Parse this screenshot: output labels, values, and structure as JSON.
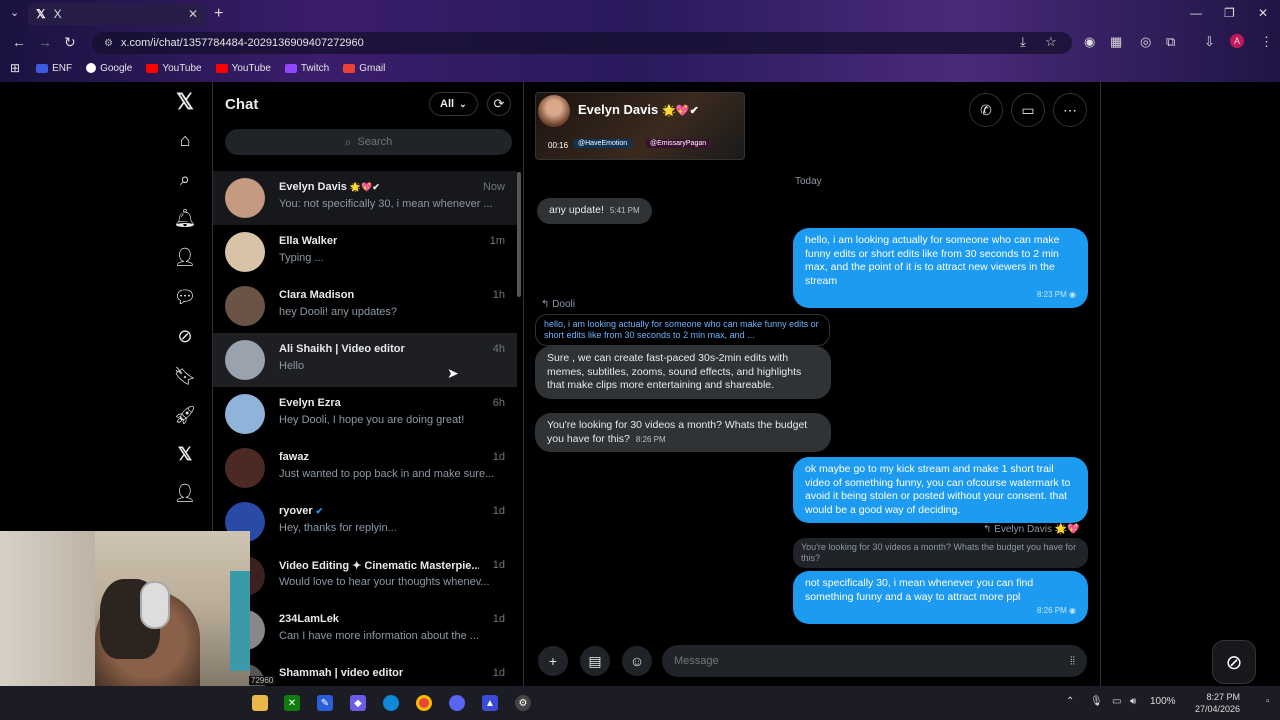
{
  "browser": {
    "tab_title": "X",
    "url": "x.com/i/chat/1357784484-2029136909407272960",
    "bookmarks": [
      {
        "label": "ENF",
        "color": "#3b5bdb"
      },
      {
        "label": "Google",
        "color": "#ffffff"
      },
      {
        "label": "YouTube",
        "color": "#ff0000"
      },
      {
        "label": "YouTube",
        "color": "#ff0000"
      },
      {
        "label": "Twitch",
        "color": "#9146ff"
      },
      {
        "label": "Gmail",
        "color": "#ea4335"
      }
    ]
  },
  "nav": {
    "items": [
      "x-logo-icon",
      "home-icon",
      "search-icon",
      "notifications-icon",
      "follow-icon",
      "chat-icon",
      "grok-icon",
      "bookmarks-icon",
      "rocket-icon",
      "premium-icon",
      "profile-icon"
    ]
  },
  "chatlist": {
    "title": "Chat",
    "filter_label": "All",
    "search_placeholder": "Search",
    "conversations": [
      {
        "name": "Evelyn Davis",
        "badge": "🌟💖✔",
        "time": "Now",
        "preview": "You: not specifically 30, i mean whenever ...",
        "avatar_color": "#c59a80"
      },
      {
        "name": "Ella Walker",
        "badge": "",
        "time": "1m",
        "preview": "Typing ...",
        "avatar_color": "#d9c3a8"
      },
      {
        "name": "Clara Madison",
        "badge": "",
        "time": "1h",
        "preview": "hey Dooli! any updates?",
        "avatar_color": "#6b5446"
      },
      {
        "name": "Ali Shaikh | Video editor",
        "badge": "",
        "time": "4h",
        "preview": "Hello",
        "avatar_color": "#9aa3ad"
      },
      {
        "name": "Evelyn Ezra",
        "badge": "",
        "time": "6h",
        "preview": "Hey Dooli, I hope you are doing great!",
        "avatar_color": "#8fb3d9"
      },
      {
        "name": "fawaz",
        "badge": "",
        "time": "1d",
        "preview": "Just wanted to pop back in and make sure...",
        "avatar_color": "#4a2a22"
      },
      {
        "name": "ryover",
        "badge": "✔",
        "time": "1d",
        "preview": "Hey, thanks for replyin...",
        "avatar_color": "#2a4aa8"
      },
      {
        "name": "Video Editing ✦ Cinematic Masterpie...",
        "badge": "",
        "time": "1d",
        "preview": "Would love to hear your thoughts whenev...",
        "avatar_color": "#3a2020"
      },
      {
        "name": "234LamLek",
        "badge": "",
        "time": "1d",
        "preview": "Can I have more information about the ...",
        "avatar_color": "#888888"
      },
      {
        "name": "Shammah | video editor",
        "badge": "",
        "time": "1d",
        "preview": "",
        "avatar_color": "#555555"
      }
    ]
  },
  "chat": {
    "contact_name": "Evelyn Davis",
    "contact_badges": "🌟💖✔",
    "video_time": "00:16",
    "video_tag1": "@HaveEmotion",
    "video_tag2": "@EmissaryPagan",
    "day_separator": "Today",
    "messages": {
      "m1": {
        "text": "any update!",
        "time": "5:41 PM"
      },
      "m2": {
        "text": "hello, i am looking actually for someone who can make funny edits or short edits like from 30 seconds to 2 min max, and the point of it is to attract new viewers in the stream",
        "time": "8:23 PM"
      },
      "q1_label": "Dooli",
      "q1_text": "hello, i am looking actually for someone who can make funny edits or short edits like from 30 seconds to 2 min max, and ...",
      "m3": {
        "text": "Sure , we can create fast-paced 30s-2min edits with memes, subtitles, zooms, sound effects, and highlights that make clips more entertaining and shareable.",
        "time": ""
      },
      "m4": {
        "text": "You're looking for 30 videos a month? Whats the budget you have for this?",
        "time": "8:26 PM"
      },
      "m5": {
        "text": "ok maybe go to my kick stream and make 1 short trail video of something funny, you can ofcourse watermark to avoid it being stolen or posted without your consent. that would be a good way of deciding.",
        "time": ""
      },
      "q2_label": "Evelyn Davis 🌟💖",
      "q2_text": "You're looking for 30 videos a month? Whats the budget you have for this?",
      "m6": {
        "text": "not specifically 30, i mean whenever you can find something funny and a way to attract more ppl",
        "time": "8:26 PM"
      }
    },
    "composer_placeholder": "Message"
  },
  "webcam_label": "72960",
  "taskbar": {
    "time": "8:27 PM",
    "date": "27/04/2026",
    "battery": "100%"
  },
  "colors": {
    "accent": "#1d9bf0",
    "incoming_bubble": "#2f3336"
  }
}
